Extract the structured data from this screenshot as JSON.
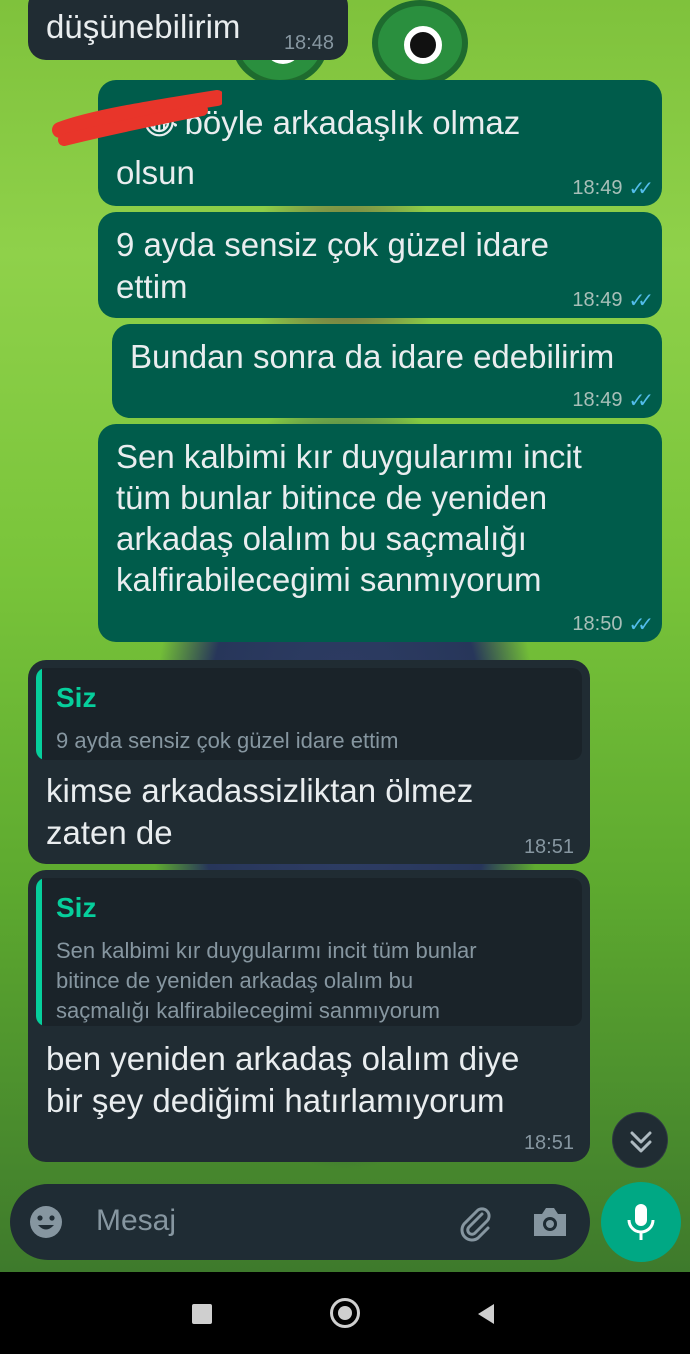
{
  "messages": [
    {
      "type": "out_top_partial",
      "text": "düşünebilirim",
      "time": "18:48"
    },
    {
      "type": "outgoing",
      "text_line1": "böyle arkadaşlık olmaz",
      "text_line2": "olsun",
      "emoji": "😂",
      "time": "18:49"
    },
    {
      "type": "outgoing",
      "text_line1": "9 ayda sensiz çok güzel idare",
      "text_line2": "ettim",
      "time": "18:49"
    },
    {
      "type": "outgoing",
      "text_line1": "Bundan sonra da idare edebilirim",
      "time": "18:49"
    },
    {
      "type": "outgoing",
      "lines": [
        "Sen kalbimi kır duygularımı incit",
        "tüm bunlar bitince de yeniden",
        "arkadaş olalım bu saçmalığı",
        "kalfirabilecegimi sanmıyorum"
      ],
      "time": "18:50"
    },
    {
      "type": "incoming_reply",
      "quote_author": "Siz",
      "quote_lines": [
        "9 ayda sensiz çok güzel idare ettim"
      ],
      "lines": [
        "kimse arkadassizliktan ölmez",
        "zaten de"
      ],
      "time": "18:51"
    },
    {
      "type": "incoming_reply",
      "quote_author": "Siz",
      "quote_lines": [
        "Sen kalbimi kır duygularımı incit tüm bunlar",
        "bitince de yeniden arkadaş olalım bu",
        "saçmalığı kalfirabilecegimi sanmıyorum"
      ],
      "lines": [
        "ben yeniden arkadaş olalım diye",
        "bir şey dediğimi hatırlamıyorum"
      ],
      "time": "18:51"
    }
  ],
  "composer": {
    "placeholder": "Mesaj",
    "icons": [
      "emoji-icon",
      "attach-icon",
      "camera-icon",
      "mic-icon"
    ]
  },
  "nav_icons": [
    "recents-icon",
    "home-icon",
    "back-icon"
  ],
  "colors": {
    "outgoing_bubble": "#005c4b",
    "incoming_bubble": "#202c33",
    "accent": "#00a884",
    "read_ticks": "#53bdeb",
    "quote_author": "#06cf9c"
  }
}
